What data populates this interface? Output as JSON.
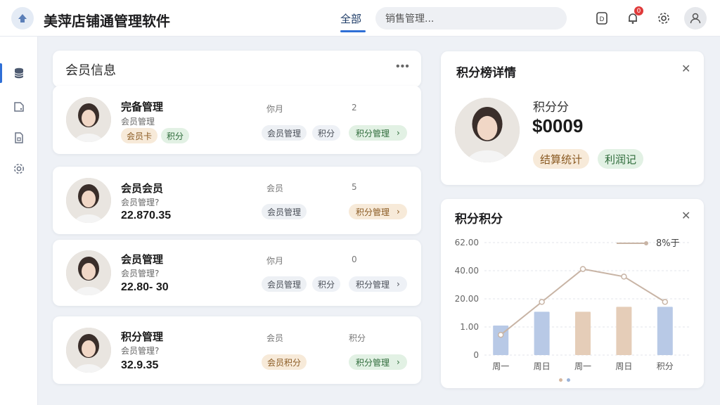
{
  "app": {
    "title": "美萍店铺通管理软件"
  },
  "topbar": {
    "tab_label": "全部",
    "search_value": "销售管理...",
    "notification_count": "0"
  },
  "member_panel": {
    "title": "会员信息",
    "members": [
      {
        "name": "完备管理",
        "sub": "会员管理",
        "amount": "",
        "label": "你月",
        "count": "2",
        "tags": [
          "会员管理",
          "积分"
        ],
        "tag_chip_orange": "会员卡",
        "tag_chip_green": "积分",
        "action": "积分管理"
      },
      {
        "name": "会员会员",
        "sub": "会员管理?",
        "amount": "22.870.35",
        "label": "会员",
        "count": "5",
        "tags": [
          "会员管理"
        ],
        "action": "积分管理"
      },
      {
        "name": "会员管理",
        "sub": "会员管理?",
        "amount": "22.80- 30",
        "label": "你月",
        "count": "0",
        "tags": [
          "会员管理",
          "积分"
        ],
        "action": "积分管理"
      },
      {
        "name": "积分管理",
        "sub": "会员管理?",
        "amount": "32.9.35",
        "label": "会员",
        "count": "积分",
        "tags": [
          "会员积分"
        ],
        "action": "积分管理"
      }
    ]
  },
  "detail_panel": {
    "title": "积分榜详情",
    "label": "积分分",
    "value": "$0009",
    "tag_orange": "结算统计",
    "tag_green": "利润记"
  },
  "chart_panel": {
    "title": "积分积分"
  },
  "chart_data": {
    "type": "bar",
    "categories": [
      "周一",
      "周日",
      "周一",
      "周日",
      "积分"
    ],
    "values": [
      15,
      22,
      22,
      24.5,
      24.5
    ],
    "series": [
      {
        "type": "line",
        "name": "8%于",
        "values": [
          8,
          21,
          34,
          31,
          21
        ]
      }
    ],
    "yticks": [
      "0",
      "1.00",
      "20.00",
      "40.00",
      "62.00"
    ],
    "ylim": [
      0,
      70
    ],
    "grid": true,
    "legend": "top-right",
    "colors": {
      "bar": "#b8c9e6",
      "bar_alt": "#e5cdb8",
      "line": "#c8b4a5"
    }
  },
  "colors": {
    "accent": "#2f6fd6",
    "badge": "#e03a3a"
  }
}
